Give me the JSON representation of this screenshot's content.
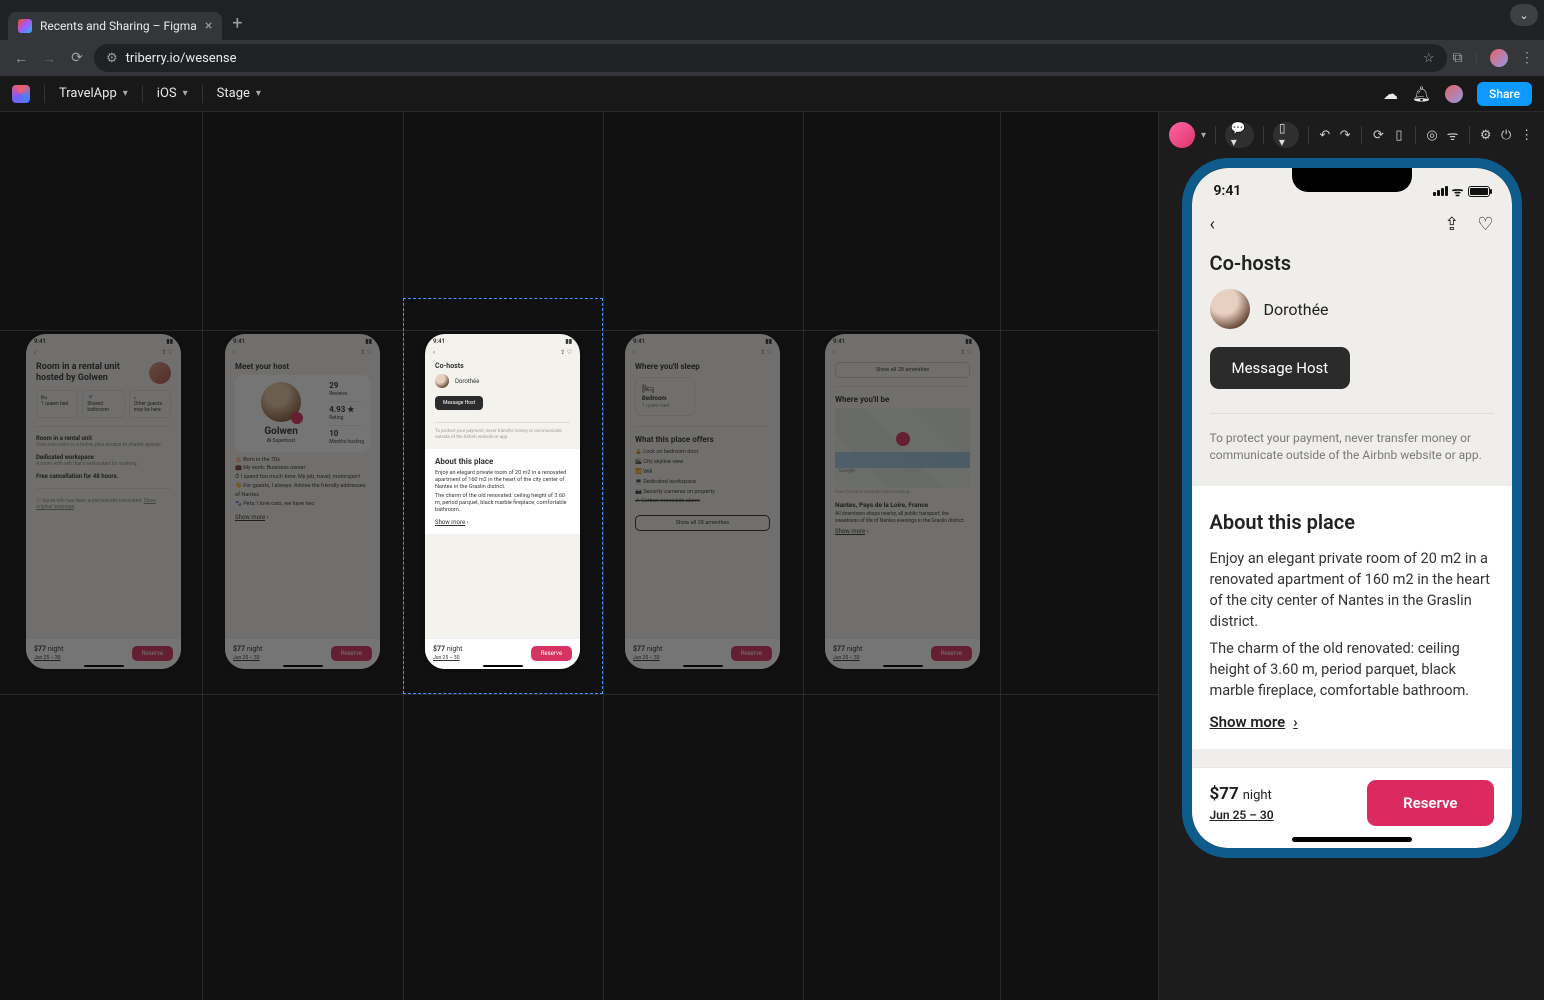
{
  "browser": {
    "tab_title": "Recents and Sharing – Figma",
    "url": "triberry.io/wesense"
  },
  "app_bar": {
    "project": "TravelApp",
    "platform": "iOS",
    "env": "Stage",
    "share": "Share"
  },
  "canvas": {
    "artboards": [
      {
        "title": "Room in a rental unit hosted by Golwen",
        "chips": [
          "1 queen bed",
          "Shared bathroom",
          "Other guests may be here"
        ],
        "lines": [
          "Room in a rental unit",
          "Your own room in a home, plus access to shared spaces.",
          "Dedicated workspace",
          "A room with wifi that's well-suited for working.",
          "Free cancellation for 48 hours."
        ],
        "note": "Some info has been automatically translated.",
        "note_link": "Show original language",
        "price": "$77",
        "unit": "night",
        "dates": "Jun 25 – 30",
        "cta": "Reserve"
      },
      {
        "title": "Meet your host",
        "host": "Golwen",
        "badge": "Superhost",
        "reviews": "29",
        "reviews_label": "Reviews",
        "rating": "4.93",
        "rating_label": "Rating",
        "years": "10",
        "years_label": "Months hosting",
        "facts": [
          "Born in the 70s",
          "My work: Business owner",
          "I spend too much time: My job, travel, motorsport",
          "For guests, I always: Advise the friendly addresses of Nantes",
          "Pets: I love cats, we have two"
        ],
        "more": "Show more",
        "price": "$77",
        "unit": "night",
        "dates": "Jun 25 – 30",
        "cta": "Reserve"
      },
      {
        "cohosts": "Co-hosts",
        "name": "Dorothée",
        "msg": "Message Host",
        "disclaimer": "To protect your payment, never transfer money or communicate outside of the Airbnb website or app.",
        "about_title": "About this place",
        "p1": "Enjoy an elegant private room of 20 m2 in a renovated apartment of 160 m2 in the heart of the city center of Nantes in the Graslin district.",
        "p2": "The charm of the old renovated: ceiling height of 3.60 m, period parquet, black marble fireplace, comfortable bathroom.",
        "more": "Show more",
        "price": "$77",
        "unit": "night",
        "dates": "Jun 25 – 30",
        "cta": "Reserve"
      },
      {
        "sleep_title": "Where you'll sleep",
        "room": "Bedroom",
        "bed": "1 queen bed",
        "offers_title": "What this place offers",
        "offers": [
          "Lock on bedroom door",
          "City skyline view",
          "Wifi",
          "Dedicated workspace",
          "Security cameras on property",
          "Carbon monoxide alarm"
        ],
        "all": "Show all 28 amenities",
        "price": "$77",
        "unit": "night",
        "dates": "Jun 25 – 30",
        "cta": "Reserve"
      },
      {
        "all": "Show all 28 amenities",
        "where_title": "Where you'll be",
        "map_attr": "Google",
        "map_note": "Exact location provided after booking.",
        "loc": "Nantes, Pays de la Loire, France",
        "loc_p": "All downtown shops nearby, all public transport, the sweetness of life of Nantes evenings in the Graslin district.",
        "more": "Show more",
        "price": "$77",
        "unit": "night",
        "dates": "Jun 25 – 30",
        "cta": "Reserve"
      }
    ]
  },
  "preview": {
    "status_time": "9:41",
    "section": "Co-hosts",
    "cohost_name": "Dorothée",
    "msg": "Message Host",
    "disclaimer": "To protect your payment, never transfer money or communicate outside of the Airbnb website or app.",
    "about_title": "About this place",
    "p1": "Enjoy an elegant private room of 20 m2 in a renovated apartment of 160 m2 in the heart of the city center of Nantes in the Graslin district.",
    "p2": "The charm of the old renovated: ceiling height of 3.60 m, period parquet, black marble fireplace, comfortable bathroom.",
    "more": "Show more",
    "price_amt": "$77",
    "price_unit": "night",
    "dates": "Jun 25 – 30",
    "reserve": "Reserve"
  },
  "thumb_time": "9:41"
}
